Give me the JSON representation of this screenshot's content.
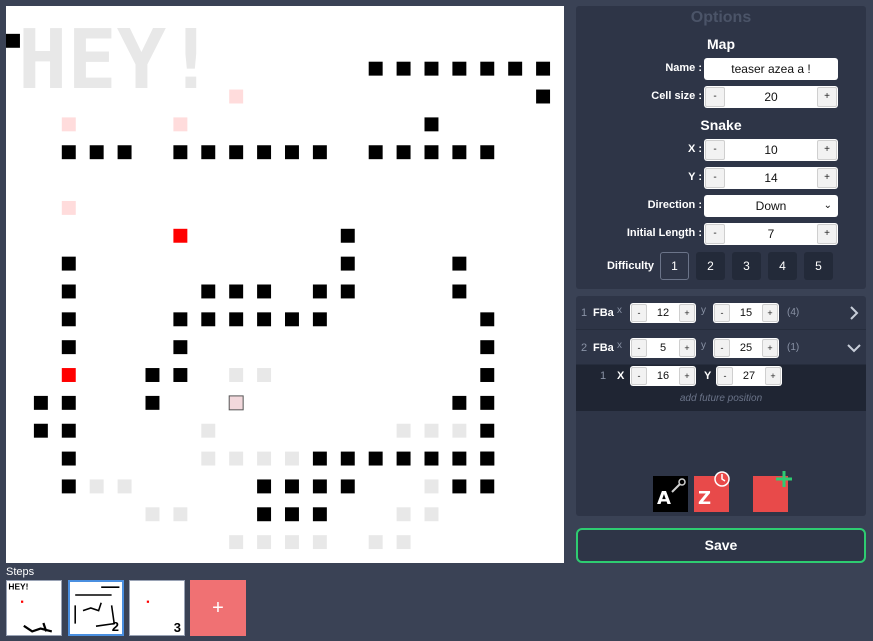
{
  "canvas": {
    "cols": 20,
    "rows": 20,
    "walls": [
      [
        0,
        1
      ],
      [
        13,
        2
      ],
      [
        14,
        2
      ],
      [
        15,
        2
      ],
      [
        16,
        2
      ],
      [
        17,
        2
      ],
      [
        18,
        2
      ],
      [
        19,
        2
      ],
      [
        19,
        3
      ],
      [
        15,
        4
      ],
      [
        2,
        5
      ],
      [
        3,
        5
      ],
      [
        4,
        5
      ],
      [
        6,
        5
      ],
      [
        7,
        5
      ],
      [
        8,
        5
      ],
      [
        9,
        5
      ],
      [
        10,
        5
      ],
      [
        11,
        5
      ],
      [
        13,
        5
      ],
      [
        14,
        5
      ],
      [
        15,
        5
      ],
      [
        16,
        5
      ],
      [
        17,
        5
      ],
      [
        12,
        8
      ],
      [
        12,
        9
      ],
      [
        16,
        9
      ],
      [
        16,
        10
      ],
      [
        2,
        9
      ],
      [
        2,
        10
      ],
      [
        2,
        11
      ],
      [
        7,
        10
      ],
      [
        8,
        10
      ],
      [
        9,
        10
      ],
      [
        11,
        10
      ],
      [
        12,
        10
      ],
      [
        2,
        12
      ],
      [
        8,
        11
      ],
      [
        9,
        11
      ],
      [
        10,
        11
      ],
      [
        11,
        11
      ],
      [
        6,
        11
      ],
      [
        17,
        11
      ],
      [
        7,
        11
      ],
      [
        6,
        12
      ],
      [
        17,
        12
      ],
      [
        5,
        13
      ],
      [
        6,
        13
      ],
      [
        17,
        13
      ],
      [
        1,
        14
      ],
      [
        2,
        14
      ],
      [
        5,
        14
      ],
      [
        16,
        14
      ],
      [
        17,
        14
      ],
      [
        17,
        15
      ],
      [
        1,
        15
      ],
      [
        17,
        16
      ],
      [
        2,
        15
      ],
      [
        2,
        16
      ],
      [
        14,
        16
      ],
      [
        15,
        16
      ],
      [
        16,
        16
      ],
      [
        17,
        16
      ],
      [
        2,
        17
      ],
      [
        11,
        16
      ],
      [
        12,
        16
      ],
      [
        13,
        16
      ],
      [
        16,
        17
      ],
      [
        17,
        17
      ],
      [
        10,
        17
      ],
      [
        11,
        17
      ],
      [
        12,
        17
      ],
      [
        9,
        18
      ],
      [
        10,
        18
      ],
      [
        11,
        18
      ],
      [
        9,
        17
      ]
    ],
    "food": [
      [
        6,
        8
      ],
      [
        2,
        13
      ]
    ],
    "past_food": [
      [
        8,
        3
      ],
      [
        2,
        4
      ],
      [
        6,
        4
      ],
      [
        2,
        7
      ]
    ],
    "future_food": [
      [
        8,
        14
      ]
    ],
    "ghost": [
      [
        8,
        13
      ],
      [
        9,
        13
      ],
      [
        8,
        14
      ],
      [
        7,
        15
      ],
      [
        7,
        16
      ],
      [
        8,
        16
      ],
      [
        9,
        16
      ],
      [
        10,
        16
      ],
      [
        14,
        15
      ],
      [
        15,
        15
      ],
      [
        16,
        15
      ],
      [
        3,
        17
      ],
      [
        4,
        17
      ],
      [
        5,
        18
      ],
      [
        6,
        18
      ],
      [
        15,
        17
      ],
      [
        16,
        17
      ],
      [
        14,
        18
      ],
      [
        15,
        18
      ],
      [
        13,
        19
      ],
      [
        14,
        19
      ],
      [
        8,
        19
      ],
      [
        9,
        19
      ],
      [
        10,
        19
      ],
      [
        11,
        19
      ]
    ],
    "ghost_text": "HEY!",
    "wall_color": "#000000",
    "food_color": "#ff0000",
    "past_food_color": "#ffdcdc",
    "ghost_color": "#e8e8e8"
  },
  "options": {
    "title": "Options",
    "map_title": "Map",
    "name_label": "Name :",
    "name_value": "teaser azea a !",
    "cellsize_label": "Cell size :",
    "cellsize_value": "20",
    "snake_title": "Snake",
    "x_label": "X :",
    "x_value": "10",
    "y_label": "Y :",
    "y_value": "14",
    "direction_label": "Direction :",
    "direction_value": "Down",
    "length_label": "Initial Length :",
    "length_value": "7",
    "difficulty_label": "Difficulty",
    "difficulties": [
      "1",
      "2",
      "3",
      "4",
      "5"
    ],
    "difficulty_selected": "1",
    "minus": "-",
    "plus": "+"
  },
  "fruits": [
    {
      "index": "1",
      "name": "FBa",
      "x": "12",
      "y": "15",
      "count": "(4)",
      "expanded": false
    },
    {
      "index": "2",
      "name": "FBa",
      "x": "5",
      "y": "25",
      "count": "(1)",
      "expanded": true
    }
  ],
  "future": {
    "index": "1",
    "x_label": "X",
    "x": "16",
    "y_label": "Y",
    "y": "27",
    "add_label": "add future position"
  },
  "axis_x": "x",
  "axis_y": "y",
  "tools": {
    "a_letter": "A",
    "z_letter": "Z",
    "accent_green": "#2ecc71",
    "accent_red": "#e84a4a"
  },
  "save_label": "Save",
  "steps_label": "Steps",
  "steps": [
    {
      "num": "",
      "active": false
    },
    {
      "num": "2",
      "active": true
    },
    {
      "num": "3",
      "active": false
    }
  ],
  "add_step": "+"
}
